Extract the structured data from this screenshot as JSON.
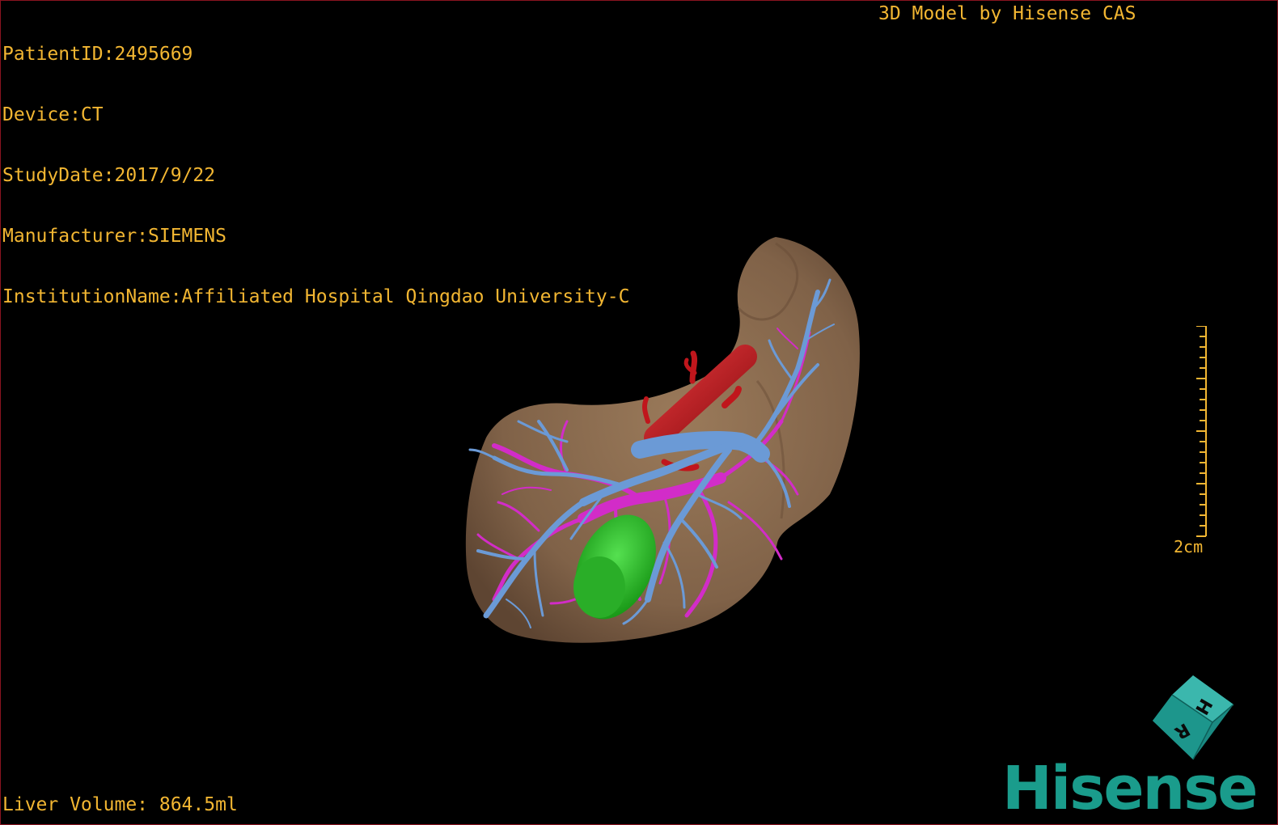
{
  "info": {
    "patient_id": "PatientID:2495669",
    "device": "Device:CT",
    "study_date": "StudyDate:2017/9/22",
    "manufacturer": "Manufacturer:SIEMENS",
    "institution": "InstitutionName:Affiliated Hospital Qingdao University-C"
  },
  "model_credit": "3D Model by Hisense CAS",
  "liver_volume": "Liver Volume: 864.5ml",
  "scale_bar": {
    "label": "2cm"
  },
  "orientation_cube": {
    "face_letters": [
      "H",
      "R"
    ]
  },
  "brand": {
    "logo_text": "Hisense"
  },
  "colors": {
    "overlay_text": "#f2b632",
    "liver": "#8a6c4f",
    "artery": "#c0161c",
    "hepatic_vein": "#6b9ad6",
    "portal_vein": "#d22cc8",
    "gallbladder": "#2fbf2a",
    "brand": "#1a9c8c"
  }
}
